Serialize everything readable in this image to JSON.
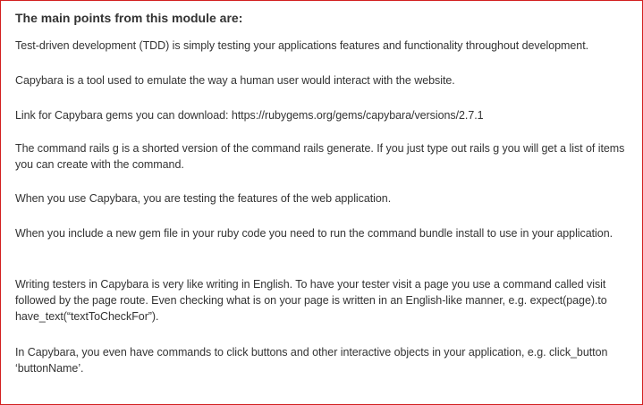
{
  "module_summary": {
    "heading": "The main points from this module are:",
    "points": [
      "Test-driven development (TDD) is simply testing your applications features and functionality throughout development.",
      "Capybara is a tool used to emulate the way a human user would interact with the website.",
      "Link for Capybara gems you can download: https://rubygems.org/gems/capybara/versions/2.7.1",
      "The command rails g is a shorted version of the command rails generate. If you just type out rails g you will get a list of items you can create with the command.",
      "When you use Capybara, you are testing the features of the web application.",
      "When you include a new gem file in your ruby code you need to run the command bundle install to use in your application.",
      "Writing testers in Capybara is very like writing in English. To have your tester visit a page you use a command called visit followed by the page route. Even checking what is on your page is written in an English-like manner, e.g. expect(page).to have_text(“textToCheckFor”).",
      "In Capybara, you even have commands to click buttons and other interactive objects in your application, e.g. click_button ‘buttonName’."
    ]
  }
}
